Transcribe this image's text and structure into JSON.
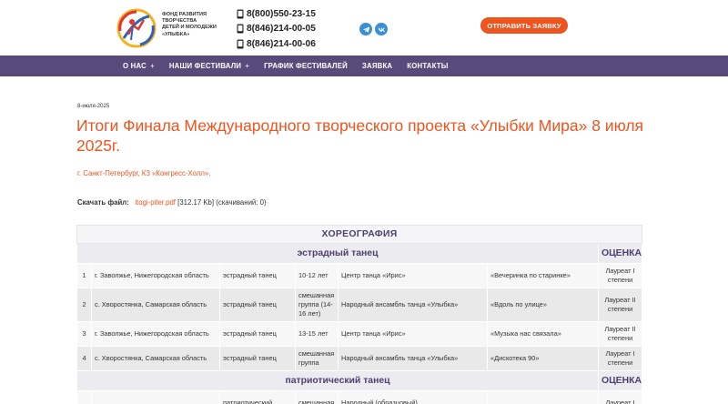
{
  "header": {
    "org_lines": [
      "ФОНД РАЗВИТИЯ",
      "ТВОРЧЕСТВА",
      "ДЕТЕЙ И МОЛОДЕЖИ",
      "«УЛЫБКА»"
    ],
    "phones": [
      "8(800)550-23-15",
      "8(846)214-00-05",
      "8(846)214-00-06"
    ],
    "social_icons": [
      "telegram-icon",
      "vk-icon"
    ],
    "cta_label": "ОТПРАВИТЬ ЗАЯВКУ",
    "colors": {
      "accent": "#f0541e",
      "nav_bg": "#5a4a7c",
      "social": "#3a8fd6"
    }
  },
  "nav": {
    "items": [
      {
        "label": "О НАС",
        "plus": "+"
      },
      {
        "label": "НАШИ ФЕСТИВАЛИ",
        "plus": "+"
      },
      {
        "label": "ГРАФИК ФЕСТИВАЛЕЙ",
        "plus": ""
      },
      {
        "label": "ЗАЯВКА",
        "plus": ""
      },
      {
        "label": "КОНТАКТЫ",
        "plus": ""
      }
    ]
  },
  "article": {
    "date": "8-июля-2025",
    "title": "Итоги Финала Международного творческого проекта «Улыбки Мира» 8 июля 2025г.",
    "venue": "г. Санкт-Петербург, КЗ «Конгресс-Холл».",
    "download": {
      "label": "Скачать файл:",
      "file": "itogi-piter.pdf",
      "size": "[312.17 Kb]",
      "downloads": "(скачиваний: 0)"
    }
  },
  "table": {
    "section_title": "ХОРЕОГРАФИЯ",
    "score_header": "ОЦЕНКА",
    "groups": [
      {
        "title": "эстрадный танец",
        "rows": [
          {
            "n": "1",
            "region": "г. Заволжье, Нижегородская область",
            "genre": "эстрадный танец",
            "age": "10-12 лет",
            "team": "Центр танца «Ирис»",
            "piece": "«Вечеринка по старинке»",
            "award": "Лауреат I степени"
          },
          {
            "n": "2",
            "region": "с. Хворостянка, Самарская область",
            "genre": "эстрадный танец",
            "age": "смешанная группа (14-16 лет)",
            "team": "Народный ансамбль танца «Улыбка»",
            "piece": "«Вдоль по улице»",
            "award": "Лауреат II степени"
          },
          {
            "n": "3",
            "region": "г. Заволжье, Нижегородская область",
            "genre": "эстрадный танец",
            "age": "13-15 лет",
            "team": "Центр танца «Ирис»",
            "piece": "«Музыка нас связала»",
            "award": "Лауреат II степени"
          },
          {
            "n": "4",
            "region": "с. Хворостянка, Самарская область",
            "genre": "эстрадный танец",
            "age": "смешанная группа",
            "team": "Народный ансамбль танца «Улыбка»",
            "piece": "«Дискотека 90»",
            "award": "Лауреат I степени"
          }
        ]
      },
      {
        "title": "патриотический танец",
        "rows": [
          {
            "n": "",
            "region": "",
            "genre": "патриотический",
            "age": "смешанная",
            "team": "Народный (образцовый)",
            "piece": "",
            "award": "Лауреат I"
          }
        ]
      }
    ]
  }
}
